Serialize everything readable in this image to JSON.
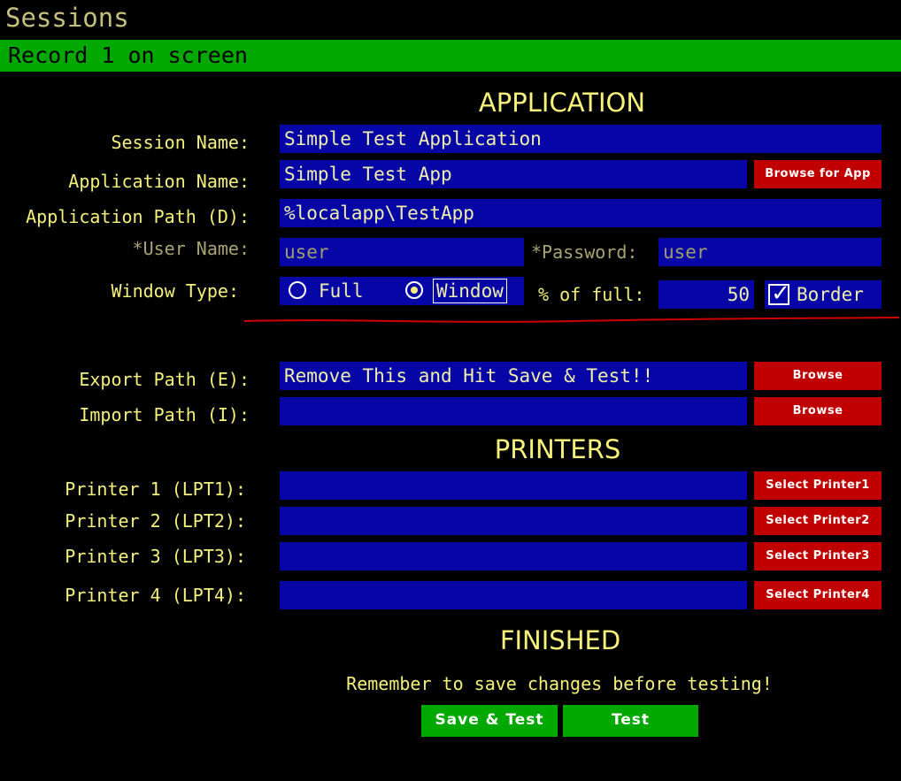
{
  "window": {
    "title": "Sessions"
  },
  "status": {
    "text": "Record 1 on screen"
  },
  "application": {
    "heading": "APPLICATION",
    "session_name_label": "Session Name:",
    "session_name_value": "Simple Test Application",
    "app_name_label": "Application Name:",
    "app_name_value": "Simple Test App",
    "browse_app_label": "Browse for App",
    "app_path_label": "Application Path (D):",
    "app_path_value": "%localapp\\TestApp",
    "user_name_label": "*User Name:",
    "user_name_value": "user",
    "password_label": "*Password:",
    "password_value": "user",
    "window_type_label": "Window Type:",
    "window_type_options": [
      "Full",
      "Window"
    ],
    "window_type_selected": "Window",
    "percent_label": "% of full:",
    "percent_value": "50",
    "border_label": "Border",
    "border_checked": true,
    "check_glyph": "✓"
  },
  "paths": {
    "export_label": "Export Path (E):",
    "export_value": "Remove This and Hit Save & Test!!",
    "import_label": "Import Path (I):",
    "import_value": "",
    "browse_label": "Browse"
  },
  "printers": {
    "heading": "PRINTERS",
    "items": [
      {
        "label": "Printer 1 (LPT1):",
        "value": "",
        "button": "Select Printer1"
      },
      {
        "label": "Printer 2 (LPT2):",
        "value": "",
        "button": "Select Printer2"
      },
      {
        "label": "Printer 3 (LPT3):",
        "value": "",
        "button": "Select Printer3"
      },
      {
        "label": "Printer 4 (LPT4):",
        "value": "",
        "button": "Select Printer4"
      }
    ]
  },
  "finished": {
    "heading": "FINISHED",
    "note": "Remember to save changes before testing!",
    "save_test_label": "Save & Test",
    "test_label": "Test"
  },
  "colors": {
    "background": "#000000",
    "status_bar": "#00a800",
    "field": "#0606a6",
    "button_red": "#c00000",
    "button_green": "#00a800",
    "text": "#f5f07a",
    "annotation_line": "#d00000"
  }
}
